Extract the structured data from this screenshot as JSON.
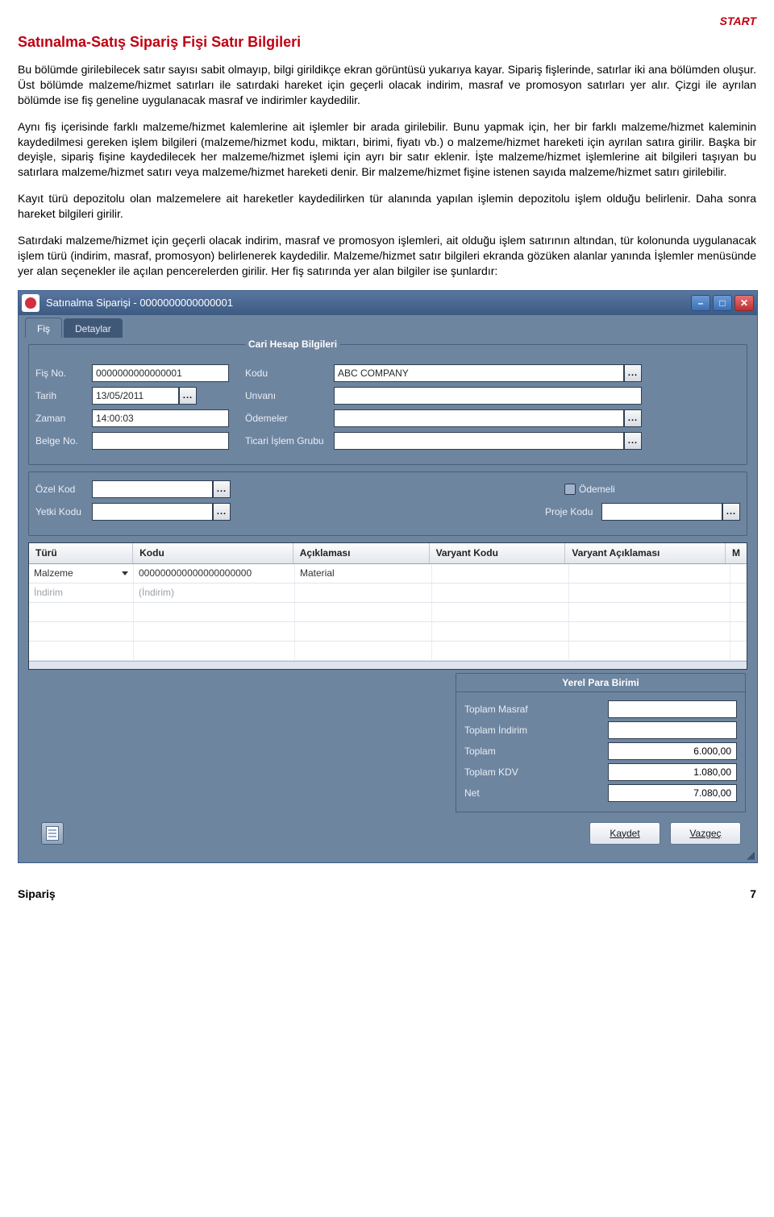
{
  "brand": "START",
  "section_title": "Satınalma-Satış Sipariş Fişi Satır Bilgileri",
  "paragraphs": {
    "p1": "Bu bölümde girilebilecek satır sayısı sabit olmayıp, bilgi girildikçe ekran görüntüsü yukarıya kayar. Sipariş fişlerinde, satırlar iki ana bölümden oluşur. Üst bölümde malzeme/hizmet satırları ile satırdaki hareket için geçerli olacak indirim, masraf ve promosyon satırları yer alır. Çizgi ile ayrılan bölümde ise fiş geneline uygulanacak masraf ve indirimler kaydedilir.",
    "p2": "Aynı fiş içerisinde farklı malzeme/hizmet kalemlerine ait işlemler bir arada girilebilir. Bunu yapmak için, her bir farklı malzeme/hizmet kaleminin kaydedilmesi gereken işlem bilgileri (malzeme/hizmet kodu, miktarı, birimi, fiyatı vb.) o malzeme/hizmet hareketi için ayrılan satıra girilir. Başka bir deyişle, sipariş fişine kaydedilecek her malzeme/hizmet işlemi için ayrı bir satır eklenir. İşte malzeme/hizmet işlemlerine ait bilgileri taşıyan bu satırlara malzeme/hizmet satırı veya malzeme/hizmet hareketi denir. Bir malzeme/hizmet fişine istenen sayıda malzeme/hizmet satırı girilebilir.",
    "p3": "Kayıt türü depozitolu olan malzemelere ait hareketler kaydedilirken tür alanında yapılan işlemin depozitolu işlem olduğu belirlenir. Daha sonra hareket bilgileri girilir.",
    "p4": "Satırdaki malzeme/hizmet için geçerli olacak indirim, masraf ve promosyon işlemleri, ait olduğu işlem satırının altından, tür kolonunda uygulanacak işlem türü (indirim, masraf, promosyon) belirlenerek kaydedilir. Malzeme/hizmet satır bilgileri ekranda gözüken alanlar yanında İşlemler menüsünde yer alan seçenekler ile açılan pencerelerden girilir. Her fiş satırında yer alan bilgiler ise şunlardır:"
  },
  "window": {
    "title": "Satınalma Siparişi - 0000000000000001",
    "tabs": {
      "fis": "Fiş",
      "detaylar": "Detaylar"
    },
    "group_title": "Cari Hesap Bilgileri",
    "labels": {
      "fis_no": "Fiş No.",
      "tarih": "Tarih",
      "zaman": "Zaman",
      "belge_no": "Belge No.",
      "kodu": "Kodu",
      "unvani": "Unvanı",
      "odemeler": "Ödemeler",
      "tislem": "Ticari İşlem Grubu",
      "ozel_kod": "Özel Kod",
      "yetki_kodu": "Yetki Kodu",
      "odemeli": "Ödemeli",
      "proje_kodu": "Proje Kodu"
    },
    "values": {
      "fis_no": "0000000000000001",
      "tarih": "13/05/2011",
      "zaman": "14:00:03",
      "belge_no": "",
      "kodu": "ABC COMPANY",
      "unvani": "",
      "odemeler": "",
      "tislem": "",
      "ozel_kod": "",
      "yetki_kodu": "",
      "proje_kodu": ""
    },
    "grid": {
      "headers": {
        "turu": "Türü",
        "kodu": "Kodu",
        "aciklamasi": "Açıklaması",
        "varyant_kodu": "Varyant Kodu",
        "varyant_acik": "Varyant Açıklaması",
        "more": "M"
      },
      "rows": [
        {
          "turu": "Malzeme",
          "kodu": "000000000000000000000",
          "aciklamasi": "Material",
          "varyant_kodu": "",
          "varyant_acik": ""
        },
        {
          "turu": "İndirim",
          "kodu": "(İndirim)",
          "aciklamasi": "",
          "varyant_kodu": "",
          "varyant_acik": ""
        }
      ]
    },
    "totals": {
      "title": "Yerel Para Birimi",
      "labels": {
        "masraf": "Toplam Masraf",
        "indirim": "Toplam İndirim",
        "toplam": "Toplam",
        "kdv": "Toplam KDV",
        "net": "Net"
      },
      "values": {
        "masraf": "",
        "indirim": "",
        "toplam": "6.000,00",
        "kdv": "1.080,00",
        "net": "7.080,00"
      }
    },
    "buttons": {
      "kaydet": "Kaydet",
      "vazgec": "Vazgeç"
    },
    "lookup_glyph": "..."
  },
  "footer": {
    "left": "Sipariş",
    "right": "7"
  }
}
